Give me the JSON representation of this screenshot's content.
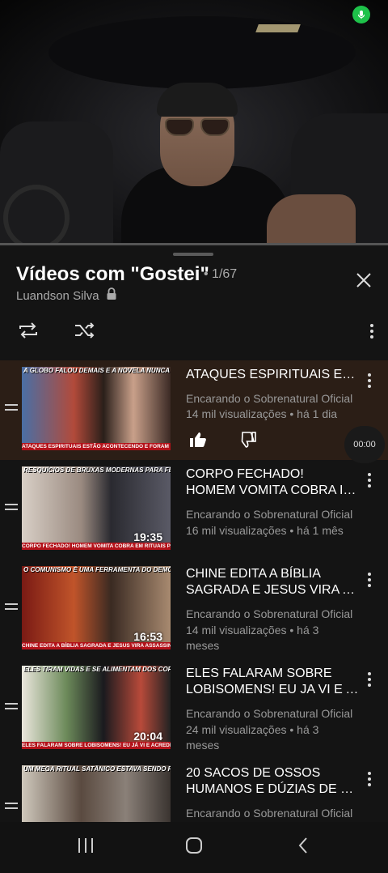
{
  "playlist": {
    "title": "Vídeos com \"Gostei\"",
    "position": "• 1/67",
    "owner": "Luandson Silva"
  },
  "icons": {
    "mic": "microphone-icon",
    "lock": "lock-icon",
    "close": "close-icon",
    "repeat": "repeat-icon",
    "shuffle": "shuffle-icon",
    "more": "more-vertical-icon",
    "drag": "drag-handle-icon",
    "like": "thumbs-up-icon",
    "dislike": "thumbs-down-icon"
  },
  "colors": {
    "accent_mic": "#1ec24a",
    "active_row": "#2b1e16",
    "caption_red": "#b3121a"
  },
  "items": [
    {
      "title_lines": [
        "ATAQUES ESPIRITUAIS ESTÃO"
      ],
      "channel": "Encarando o Sobrenatural Oficial",
      "meta": "14 mil visualizações • há 1 dia",
      "duration": "",
      "thumb_top": "A GLOBO FALOU DEMAIS E A NOVELA NUNCA MAIS PODE SER EXIBIDA",
      "thumb_caption": "ATAQUES ESPIRITUAIS ESTÃO ACONTECENDO E FORAM REVELADOS EM VELHA NOVELA DA GLOBO OLHO NO OLHO!",
      "active": true,
      "time_pill": "00:00"
    },
    {
      "title_lines": [
        "CORPO FECHADO!",
        "HOMEM VOMITA COBRA INVOCANDO"
      ],
      "channel": "Encarando o Sobrenatural Oficial",
      "meta": "16 mil visualizações • há 1 mês",
      "duration": "19:35",
      "thumb_top": "RESQUÍCIOS DE BRUXAS MODERNAS PARA FECHAR O CORPO!",
      "thumb_caption": "CORPO FECHADO! HOMEM VOMITA COBRA EM RITUAIS PARA INVULNERABILIDADE",
      "active": false
    },
    {
      "title_lines": [
        "CHINE EDITA A BÍBLIA",
        "SAGRADA E JESUS VIRA ASSASSINO"
      ],
      "channel": "Encarando o Sobrenatural Oficial",
      "meta": "14 mil visualizações • há 3 meses",
      "duration": "16:53",
      "thumb_top": "O COMUNISMO É UMA FERRAMENTA DO DEMÔNIO",
      "thumb_caption": "CHINE EDITA A BÍBLIA SAGRADA E JESUS VIRA ASSASSINO NA NOVA VERSÃO!",
      "active": false
    },
    {
      "title_lines": [
        "ELES FALARAM SOBRE",
        "LOBISOMENS! EU JA VI E ACREDITO"
      ],
      "channel": "Encarando o Sobrenatural Oficial",
      "meta": "24 mil visualizações • há 3 meses",
      "duration": "20:04",
      "thumb_top": "ELES TIRAM VIDAS E SE ALIMENTAM DOS CORPOS",
      "thumb_caption": "ELES FALARAM SOBRE LOBISOMENS! EU JÁ VI E ACREDITO NA EXISTÊNCIA DELES!",
      "active": false
    },
    {
      "title_lines": [
        "20 SACOS DE OSSOS",
        "HUMANOS E DÚZIAS DE CRÂNIOS"
      ],
      "channel": "Encarando o Sobrenatural Oficial",
      "meta": "",
      "duration": "",
      "thumb_top": "UM MEGA RITUAL SATÂNICO ESTAVA SENDO REALIZADO",
      "thumb_caption": "",
      "active": false
    }
  ]
}
